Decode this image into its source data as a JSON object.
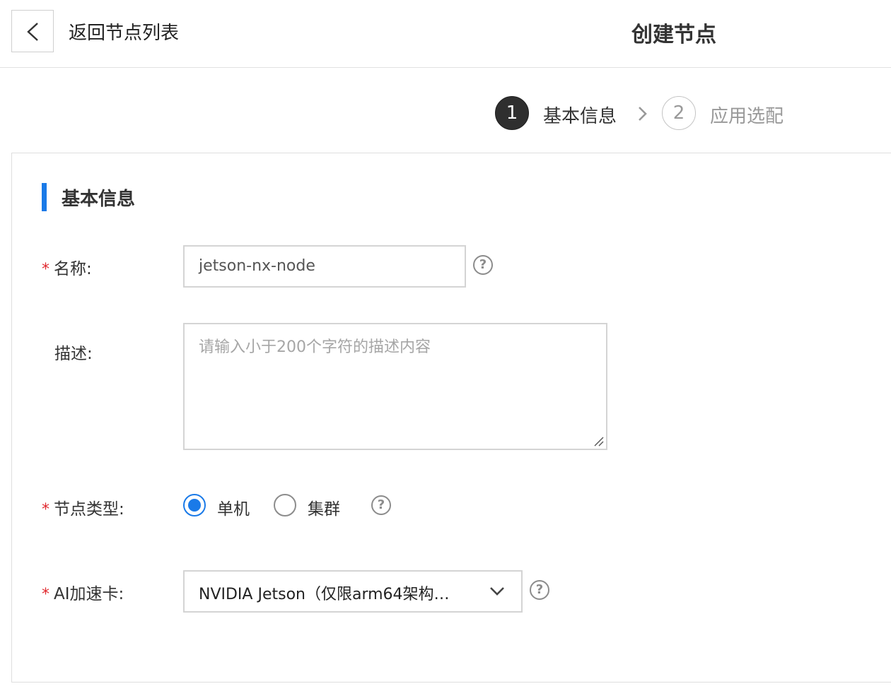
{
  "header": {
    "back_label": "返回节点列表",
    "page_title": "创建节点"
  },
  "steps": [
    {
      "number": "1",
      "label": "基本信息",
      "active": true
    },
    {
      "number": "2",
      "label": "应用选配",
      "active": false
    }
  ],
  "section": {
    "title": "基本信息"
  },
  "form": {
    "required_mark": "*",
    "name": {
      "label": "名称:",
      "value": "jetson-nx-node",
      "help": "?"
    },
    "description": {
      "label": "描述:",
      "placeholder": "请输入小于200个字符的描述内容"
    },
    "node_type": {
      "label": "节点类型:",
      "options": [
        {
          "label": "单机",
          "checked": true
        },
        {
          "label": "集群",
          "checked": false
        }
      ],
      "help": "?"
    },
    "ai_card": {
      "label": "AI加速卡:",
      "value": "NVIDIA Jetson（仅限arm64架构…",
      "help": "?"
    }
  },
  "colors": {
    "accent": "#1a7ae8",
    "required": "#e0282e",
    "step_active": "#2f2f2f"
  }
}
